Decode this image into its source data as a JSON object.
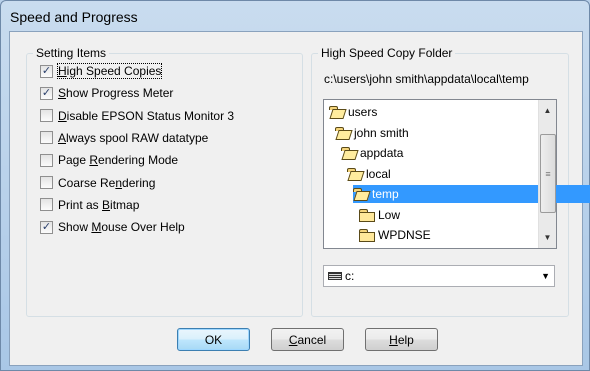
{
  "window": {
    "title": "Speed and Progress"
  },
  "settings": {
    "group_label": "Setting Items",
    "items": [
      {
        "pre": "",
        "u": "H",
        "post": "igh Speed Copies",
        "checked": true,
        "focused": true
      },
      {
        "pre": "",
        "u": "S",
        "post": "how Progress Meter",
        "checked": true
      },
      {
        "pre": "",
        "u": "D",
        "post": "isable EPSON Status Monitor 3",
        "checked": false
      },
      {
        "pre": "",
        "u": "A",
        "post": "lways spool RAW datatype",
        "checked": false
      },
      {
        "pre": "Page ",
        "u": "R",
        "post": "endering Mode",
        "checked": false
      },
      {
        "pre": "Coarse Re",
        "u": "n",
        "post": "dering",
        "checked": false
      },
      {
        "pre": "Print as ",
        "u": "B",
        "post": "itmap",
        "checked": false
      },
      {
        "pre": "Show ",
        "u": "M",
        "post": "ouse Over Help",
        "checked": true
      }
    ]
  },
  "folder": {
    "group_label": "High Speed Copy Folder",
    "path": "c:\\users\\john smith\\appdata\\local\\temp",
    "tree": [
      {
        "label": "users",
        "depth": 0,
        "open": true,
        "selected": false
      },
      {
        "label": "john smith",
        "depth": 1,
        "open": true,
        "selected": false
      },
      {
        "label": "appdata",
        "depth": 2,
        "open": true,
        "selected": false
      },
      {
        "label": "local",
        "depth": 3,
        "open": true,
        "selected": false
      },
      {
        "label": "temp",
        "depth": 4,
        "open": true,
        "selected": true
      },
      {
        "label": "Low",
        "depth": 5,
        "open": false,
        "selected": false
      },
      {
        "label": "WPDNSE",
        "depth": 5,
        "open": false,
        "selected": false
      }
    ],
    "drive": "c:"
  },
  "buttons": {
    "ok": {
      "pre": "",
      "u": "",
      "post": "OK"
    },
    "cancel": {
      "pre": "",
      "u": "C",
      "post": "ancel"
    },
    "help": {
      "pre": "",
      "u": "H",
      "post": "elp"
    }
  },
  "icons": {
    "check": "✓",
    "scroll_up": "▲",
    "scroll_down": "▼",
    "dropdown": "▼",
    "grip": "≡"
  }
}
